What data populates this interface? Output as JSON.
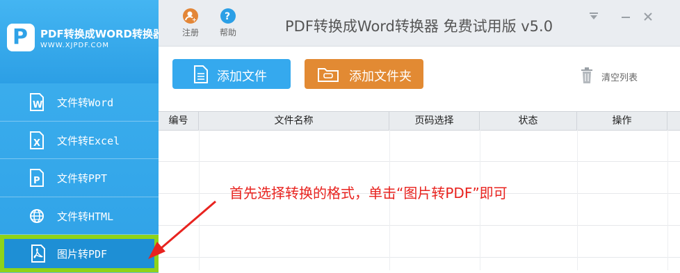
{
  "brand": {
    "title": "PDF转换成WORD转换器",
    "url": "WWW.XJPDF.COM"
  },
  "sidebar": {
    "items": [
      {
        "label": "文件转Word",
        "icon": "word-doc-icon"
      },
      {
        "label": "文件转Excel",
        "icon": "excel-doc-icon"
      },
      {
        "label": "文件转PPT",
        "icon": "ppt-doc-icon"
      },
      {
        "label": "文件转HTML",
        "icon": "globe-icon"
      },
      {
        "label": "图片转PDF",
        "icon": "pdf-doc-icon"
      }
    ],
    "active_index": 4
  },
  "header": {
    "register": "注册",
    "help": "帮助",
    "title": "PDF转换成Word转换器 免费试用版 v5.0"
  },
  "toolbar": {
    "add_file": "添加文件",
    "add_folder": "添加文件夹",
    "clear_list": "清空列表"
  },
  "table": {
    "columns": [
      "编号",
      "文件名称",
      "页码选择",
      "状态",
      "操作"
    ]
  },
  "annotation": "首先选择转换的格式，单击“图片转PDF”即可",
  "colors": {
    "sidebar": "#2fa2e7",
    "add_button": "#35a9ee",
    "folder_button": "#e28a33",
    "highlight": "#8ed31a",
    "annotation": "#e8231f"
  }
}
